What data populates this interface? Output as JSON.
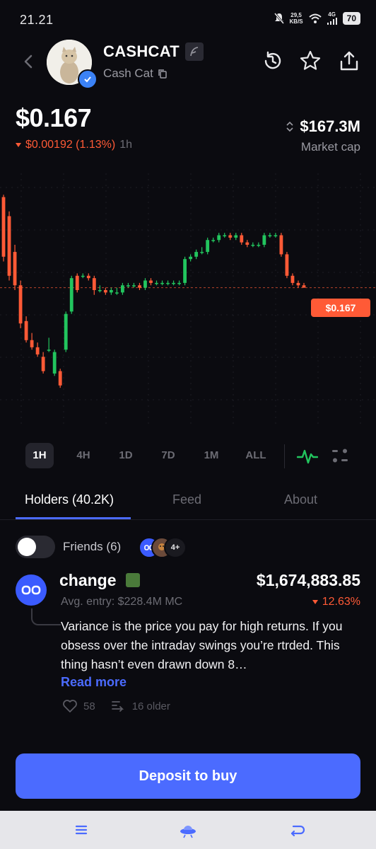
{
  "status": {
    "time": "21.21",
    "net_speed_value": "29,5",
    "net_speed_unit": "KB/S",
    "network": "4G",
    "battery": "70"
  },
  "header": {
    "name": "CASHCAT",
    "subtitle": "Cash Cat"
  },
  "price": {
    "value": "$0.167",
    "change": "$0.00192 (1.13%)",
    "period": "1h",
    "market_cap_value": "$167.3M",
    "market_cap_label": "Market cap",
    "tag": "$0.167"
  },
  "colors": {
    "up": "#22c55e",
    "down": "#ff5a36",
    "accent": "#4b6bff"
  },
  "chart_data": {
    "type": "candlestick",
    "candles": [
      {
        "o": 0.205,
        "h": 0.206,
        "l": 0.178,
        "c": 0.18
      },
      {
        "o": 0.197,
        "h": 0.199,
        "l": 0.17,
        "c": 0.172
      },
      {
        "o": 0.182,
        "h": 0.185,
        "l": 0.166,
        "c": 0.168
      },
      {
        "o": 0.168,
        "h": 0.17,
        "l": 0.15,
        "c": 0.152
      },
      {
        "o": 0.153,
        "h": 0.155,
        "l": 0.144,
        "c": 0.145
      },
      {
        "o": 0.145,
        "h": 0.148,
        "l": 0.141,
        "c": 0.142
      },
      {
        "o": 0.142,
        "h": 0.144,
        "l": 0.138,
        "c": 0.139
      },
      {
        "o": 0.138,
        "h": 0.14,
        "l": 0.131,
        "c": 0.132
      },
      {
        "o": 0.141,
        "h": 0.146,
        "l": 0.14,
        "c": 0.141
      },
      {
        "o": 0.131,
        "h": 0.141,
        "l": 0.13,
        "c": 0.14
      },
      {
        "o": 0.132,
        "h": 0.133,
        "l": 0.125,
        "c": 0.126
      },
      {
        "o": 0.141,
        "h": 0.157,
        "l": 0.14,
        "c": 0.156
      },
      {
        "o": 0.157,
        "h": 0.172,
        "l": 0.156,
        "c": 0.171
      },
      {
        "o": 0.172,
        "h": 0.173,
        "l": 0.165,
        "c": 0.166
      },
      {
        "o": 0.172,
        "h": 0.173,
        "l": 0.171,
        "c": 0.172
      },
      {
        "o": 0.172,
        "h": 0.173,
        "l": 0.17,
        "c": 0.171
      },
      {
        "o": 0.171,
        "h": 0.172,
        "l": 0.164,
        "c": 0.166
      },
      {
        "o": 0.166,
        "h": 0.168,
        "l": 0.165,
        "c": 0.166
      },
      {
        "o": 0.166,
        "h": 0.167,
        "l": 0.164,
        "c": 0.165
      },
      {
        "o": 0.165,
        "h": 0.167,
        "l": 0.164,
        "c": 0.166
      },
      {
        "o": 0.165,
        "h": 0.167,
        "l": 0.164,
        "c": 0.165
      },
      {
        "o": 0.165,
        "h": 0.169,
        "l": 0.164,
        "c": 0.168
      },
      {
        "o": 0.168,
        "h": 0.169,
        "l": 0.167,
        "c": 0.168
      },
      {
        "o": 0.168,
        "h": 0.169,
        "l": 0.167,
        "c": 0.168
      },
      {
        "o": 0.168,
        "h": 0.169,
        "l": 0.166,
        "c": 0.167
      },
      {
        "o": 0.167,
        "h": 0.171,
        "l": 0.166,
        "c": 0.17
      },
      {
        "o": 0.17,
        "h": 0.171,
        "l": 0.168,
        "c": 0.169
      },
      {
        "o": 0.169,
        "h": 0.17,
        "l": 0.168,
        "c": 0.169
      },
      {
        "o": 0.169,
        "h": 0.17,
        "l": 0.168,
        "c": 0.169
      },
      {
        "o": 0.169,
        "h": 0.17,
        "l": 0.168,
        "c": 0.169
      },
      {
        "o": 0.169,
        "h": 0.17,
        "l": 0.168,
        "c": 0.169
      },
      {
        "o": 0.169,
        "h": 0.17,
        "l": 0.168,
        "c": 0.169
      },
      {
        "o": 0.169,
        "h": 0.18,
        "l": 0.168,
        "c": 0.179
      },
      {
        "o": 0.179,
        "h": 0.181,
        "l": 0.178,
        "c": 0.18
      },
      {
        "o": 0.18,
        "h": 0.183,
        "l": 0.179,
        "c": 0.182
      },
      {
        "o": 0.182,
        "h": 0.184,
        "l": 0.181,
        "c": 0.182
      },
      {
        "o": 0.182,
        "h": 0.188,
        "l": 0.181,
        "c": 0.187
      },
      {
        "o": 0.187,
        "h": 0.188,
        "l": 0.186,
        "c": 0.187
      },
      {
        "o": 0.187,
        "h": 0.19,
        "l": 0.186,
        "c": 0.189
      },
      {
        "o": 0.189,
        "h": 0.19,
        "l": 0.188,
        "c": 0.189
      },
      {
        "o": 0.189,
        "h": 0.19,
        "l": 0.187,
        "c": 0.188
      },
      {
        "o": 0.188,
        "h": 0.19,
        "l": 0.187,
        "c": 0.189
      },
      {
        "o": 0.189,
        "h": 0.19,
        "l": 0.185,
        "c": 0.186
      },
      {
        "o": 0.186,
        "h": 0.187,
        "l": 0.184,
        "c": 0.185
      },
      {
        "o": 0.185,
        "h": 0.186,
        "l": 0.184,
        "c": 0.185
      },
      {
        "o": 0.185,
        "h": 0.186,
        "l": 0.184,
        "c": 0.185
      },
      {
        "o": 0.185,
        "h": 0.19,
        "l": 0.184,
        "c": 0.189
      },
      {
        "o": 0.189,
        "h": 0.19,
        "l": 0.188,
        "c": 0.189
      },
      {
        "o": 0.189,
        "h": 0.19,
        "l": 0.188,
        "c": 0.189
      },
      {
        "o": 0.189,
        "h": 0.19,
        "l": 0.18,
        "c": 0.181
      },
      {
        "o": 0.181,
        "h": 0.182,
        "l": 0.171,
        "c": 0.172
      },
      {
        "o": 0.172,
        "h": 0.173,
        "l": 0.168,
        "c": 0.169
      },
      {
        "o": 0.169,
        "h": 0.17,
        "l": 0.167,
        "c": 0.168
      },
      {
        "o": 0.168,
        "h": 0.169,
        "l": 0.167,
        "c": 0.167
      }
    ],
    "current_price": 0.167,
    "ylim": [
      0.12,
      0.212
    ]
  },
  "timeframes": [
    "1H",
    "4H",
    "1D",
    "7D",
    "1M",
    "ALL"
  ],
  "active_timeframe": "1H",
  "tabs": [
    "Holders (40.2K)",
    "Feed",
    "About"
  ],
  "friends": {
    "label": "Friends (6)",
    "more": "4+"
  },
  "post": {
    "author": "change",
    "amount": "$1,674,883.85",
    "entry": "Avg. entry: $228.4M MC",
    "pct": "12.63%",
    "text": "Variance is the price you pay for high returns. If you obsess over the intraday swings you’re rtrded. This thing hasn’t even drawn down 8…",
    "read_more": "Read more",
    "likes": "58",
    "older": "16 older"
  },
  "cta": {
    "deposit_label": "Deposit to buy"
  }
}
